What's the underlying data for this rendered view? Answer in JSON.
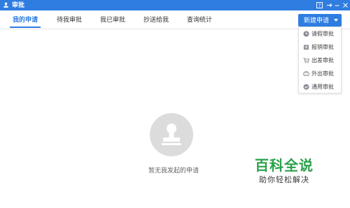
{
  "window": {
    "title": "审批",
    "accent": "#2f7de1",
    "controls": [
      "help-icon",
      "pin-icon",
      "minimize-icon",
      "close-icon"
    ]
  },
  "tabs": [
    {
      "label": "我的申请",
      "active": true
    },
    {
      "label": "待我审批",
      "active": false
    },
    {
      "label": "我已审批",
      "active": false
    },
    {
      "label": "抄送给我",
      "active": false
    },
    {
      "label": "查询统计",
      "active": false
    }
  ],
  "new_button": {
    "label": "新建申请"
  },
  "menu": {
    "items": [
      {
        "label": "请假审批",
        "icon": "clock-icon"
      },
      {
        "label": "报销审批",
        "icon": "wallet-icon"
      },
      {
        "label": "出差审批",
        "icon": "cart-icon"
      },
      {
        "label": "外出审批",
        "icon": "car-icon"
      },
      {
        "label": "通用审批",
        "icon": "check-circle-icon"
      }
    ]
  },
  "empty_state": {
    "text": "暂无我发起的申请",
    "icon": "stamp-icon"
  },
  "watermark": {
    "title": "百科全说",
    "subtitle": "助你轻松解决"
  }
}
